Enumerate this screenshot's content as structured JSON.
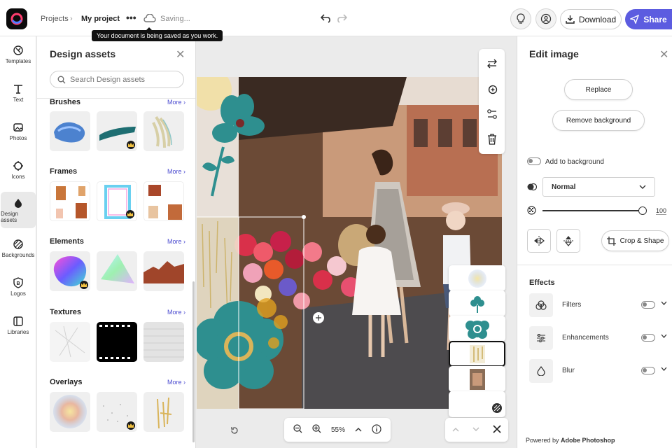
{
  "header": {
    "breadcrumb_projects": "Projects",
    "project_name": "My project",
    "saving_status": "Saving...",
    "tooltip": "Your document is being saved as you work.",
    "download_label": "Download",
    "share_label": "Share"
  },
  "rail": {
    "items": [
      {
        "label": "Templates",
        "icon": "templates-icon"
      },
      {
        "label": "Text",
        "icon": "text-icon"
      },
      {
        "label": "Photos",
        "icon": "photos-icon"
      },
      {
        "label": "Icons",
        "icon": "icons-icon"
      },
      {
        "label": "Design assets",
        "icon": "design-assets-icon"
      },
      {
        "label": "Backgrounds",
        "icon": "backgrounds-icon"
      },
      {
        "label": "Logos",
        "icon": "logos-icon"
      },
      {
        "label": "Libraries",
        "icon": "libraries-icon"
      }
    ]
  },
  "assets_panel": {
    "title": "Design assets",
    "search_placeholder": "Search Design assets",
    "more_label": "More ›",
    "sections": [
      {
        "title": "Brushes"
      },
      {
        "title": "Frames"
      },
      {
        "title": "Elements"
      },
      {
        "title": "Textures"
      },
      {
        "title": "Overlays"
      }
    ]
  },
  "canvas": {
    "zoom_level": "55%"
  },
  "edit_panel": {
    "title": "Edit image",
    "replace_label": "Replace",
    "remove_bg_label": "Remove background",
    "add_to_bg_label": "Add to background",
    "blend_mode": "Normal",
    "opacity_value": "100",
    "crop_label": "Crop & Shape",
    "effects_title": "Effects",
    "effects": [
      {
        "label": "Filters",
        "icon": "filters-icon"
      },
      {
        "label": "Enhancements",
        "icon": "enhancements-icon"
      },
      {
        "label": "Blur",
        "icon": "blur-icon"
      }
    ],
    "powered_prefix": "Powered by ",
    "powered_brand": "Adobe Photoshop"
  },
  "colors": {
    "accent": "#5c5ce0",
    "teal": "#2e8f8f",
    "link": "#4b4bd0"
  }
}
